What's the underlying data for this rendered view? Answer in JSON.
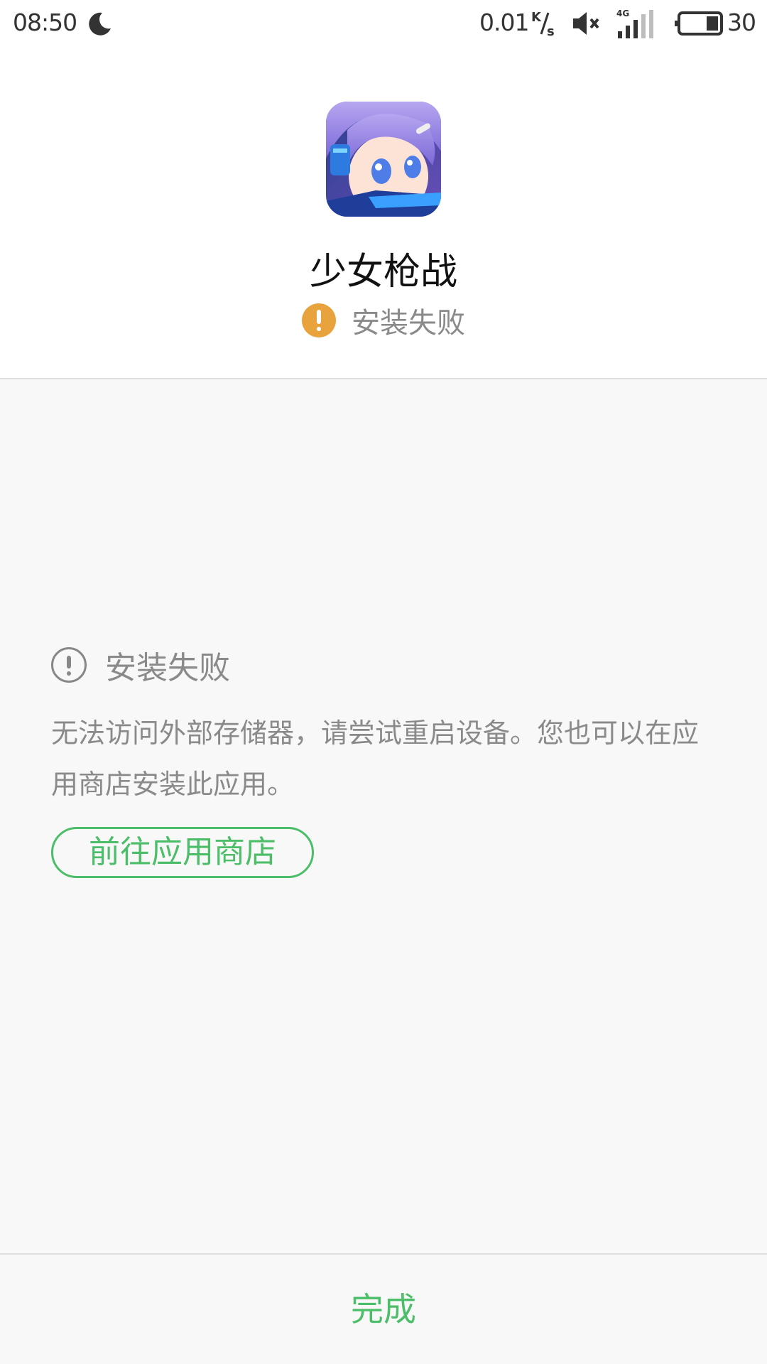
{
  "status_bar": {
    "time": "08:50",
    "network_speed": "0.01",
    "network_speed_unit": "K/s",
    "network_type": "4G",
    "battery_level": "30",
    "icons": [
      "moon-icon",
      "speed-unit-icon",
      "mute-icon",
      "signal-icon",
      "battery-icon"
    ]
  },
  "app": {
    "name": "少女枪战",
    "install_status": "安装失败",
    "icon": "app-icon"
  },
  "error": {
    "title": "安装失败",
    "message": "无法访问外部存储器，请尝试重启设备。您也可以在应用商店安装此应用。",
    "store_button_label": "前往应用商店"
  },
  "footer": {
    "done_label": "完成"
  },
  "colors": {
    "accent_green": "#4cbd68",
    "warning_orange": "#e8a33d",
    "muted_text": "#8a8a8a",
    "content_background": "#f8f8f8"
  }
}
